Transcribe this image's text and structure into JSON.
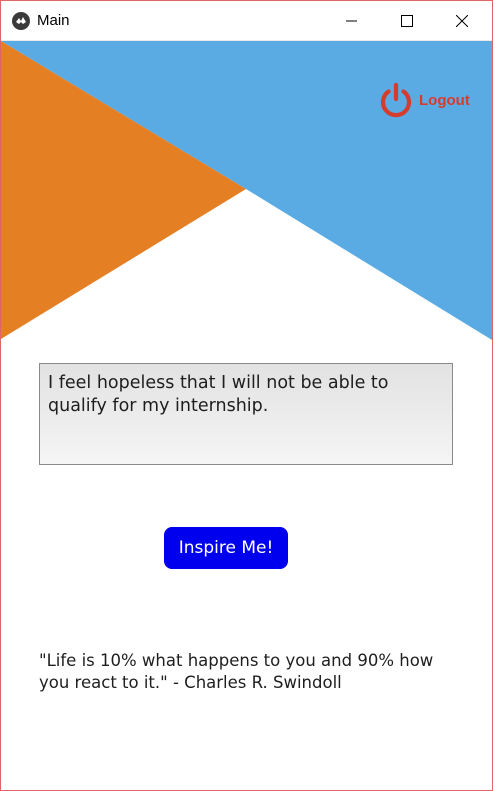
{
  "window": {
    "title": "Main",
    "controls": {
      "minimize_icon": "minimize-icon",
      "maximize_icon": "maximize-icon",
      "close_icon": "close-icon"
    }
  },
  "header": {
    "logout_label": "Logout",
    "logout_icon": "power-icon",
    "colors": {
      "blue": "#5aabe3",
      "orange": "#e57f24",
      "logout_red": "#d63c2e"
    }
  },
  "entry": {
    "text": "I feel hopeless that I will not be able to qualify for my internship."
  },
  "actions": {
    "inspire_label": "Inspire Me!",
    "inspire_color": "#0000ee"
  },
  "quote": {
    "text": "\"Life is 10% what happens to you and 90% how you react to it.\" - Charles R. Swindoll"
  }
}
